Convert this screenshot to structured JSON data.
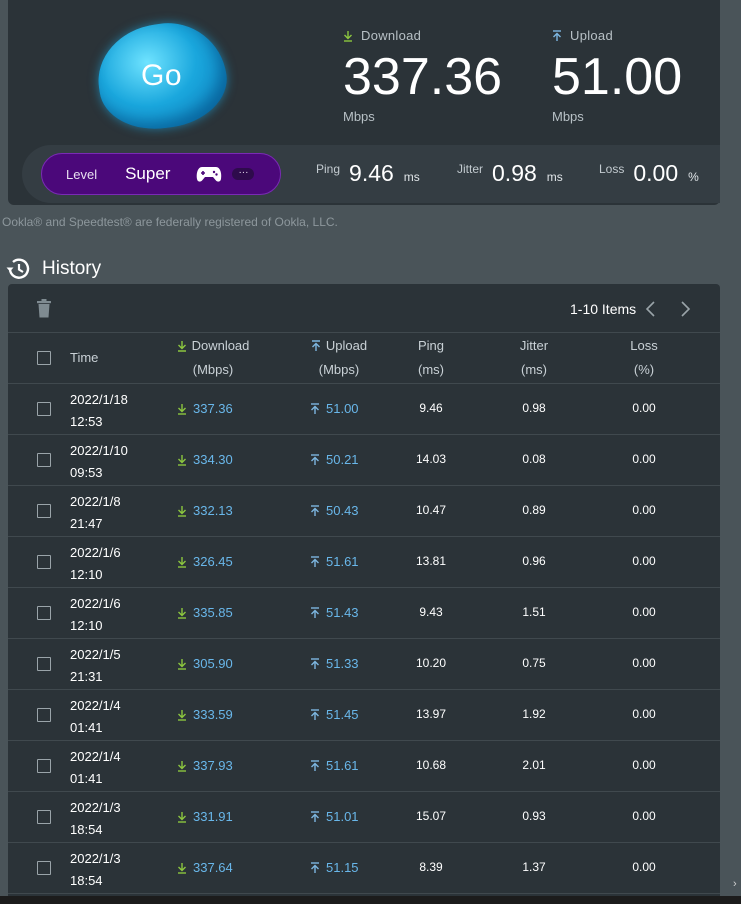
{
  "go_button": {
    "label": "Go"
  },
  "download": {
    "label": "Download",
    "value": "337.36",
    "unit": "Mbps"
  },
  "upload": {
    "label": "Upload",
    "value": "51.00",
    "unit": "Mbps"
  },
  "level": {
    "label": "Level",
    "value": "Super",
    "more": "···"
  },
  "ping": {
    "label": "Ping",
    "value": "9.46",
    "unit": "ms"
  },
  "jitter": {
    "label": "Jitter",
    "value": "0.98",
    "unit": "ms"
  },
  "loss": {
    "label": "Loss",
    "value": "0.00",
    "unit": "%"
  },
  "footnote": "Ookla® and Speedtest® are federally registered of Ookla, LLC.",
  "history": {
    "title": "History",
    "pager": {
      "text": "1-10 Items"
    },
    "columns": {
      "time": "Time",
      "download": "Download",
      "download_unit": "(Mbps)",
      "upload": "Upload",
      "upload_unit": "(Mbps)",
      "ping": "Ping",
      "ping_unit": "(ms)",
      "jitter": "Jitter",
      "jitter_unit": "(ms)",
      "loss": "Loss",
      "loss_unit": "(%)"
    },
    "rows": [
      {
        "date": "2022/1/18",
        "time": "12:53",
        "download": "337.36",
        "upload": "51.00",
        "ping": "9.46",
        "jitter": "0.98",
        "loss": "0.00"
      },
      {
        "date": "2022/1/10",
        "time": "09:53",
        "download": "334.30",
        "upload": "50.21",
        "ping": "14.03",
        "jitter": "0.08",
        "loss": "0.00"
      },
      {
        "date": "2022/1/8",
        "time": "21:47",
        "download": "332.13",
        "upload": "50.43",
        "ping": "10.47",
        "jitter": "0.89",
        "loss": "0.00"
      },
      {
        "date": "2022/1/6",
        "time": "12:10",
        "download": "326.45",
        "upload": "51.61",
        "ping": "13.81",
        "jitter": "0.96",
        "loss": "0.00"
      },
      {
        "date": "2022/1/6",
        "time": "12:10",
        "download": "335.85",
        "upload": "51.43",
        "ping": "9.43",
        "jitter": "1.51",
        "loss": "0.00"
      },
      {
        "date": "2022/1/5",
        "time": "21:31",
        "download": "305.90",
        "upload": "51.33",
        "ping": "10.20",
        "jitter": "0.75",
        "loss": "0.00"
      },
      {
        "date": "2022/1/4",
        "time": "01:41",
        "download": "333.59",
        "upload": "51.45",
        "ping": "13.97",
        "jitter": "1.92",
        "loss": "0.00"
      },
      {
        "date": "2022/1/4",
        "time": "01:41",
        "download": "337.93",
        "upload": "51.61",
        "ping": "10.68",
        "jitter": "2.01",
        "loss": "0.00"
      },
      {
        "date": "2022/1/3",
        "time": "18:54",
        "download": "331.91",
        "upload": "51.01",
        "ping": "15.07",
        "jitter": "0.93",
        "loss": "0.00"
      },
      {
        "date": "2022/1/3",
        "time": "18:54",
        "download": "337.64",
        "upload": "51.15",
        "ping": "8.39",
        "jitter": "1.37",
        "loss": "0.00"
      }
    ]
  },
  "scrollbar_glyph": "›"
}
